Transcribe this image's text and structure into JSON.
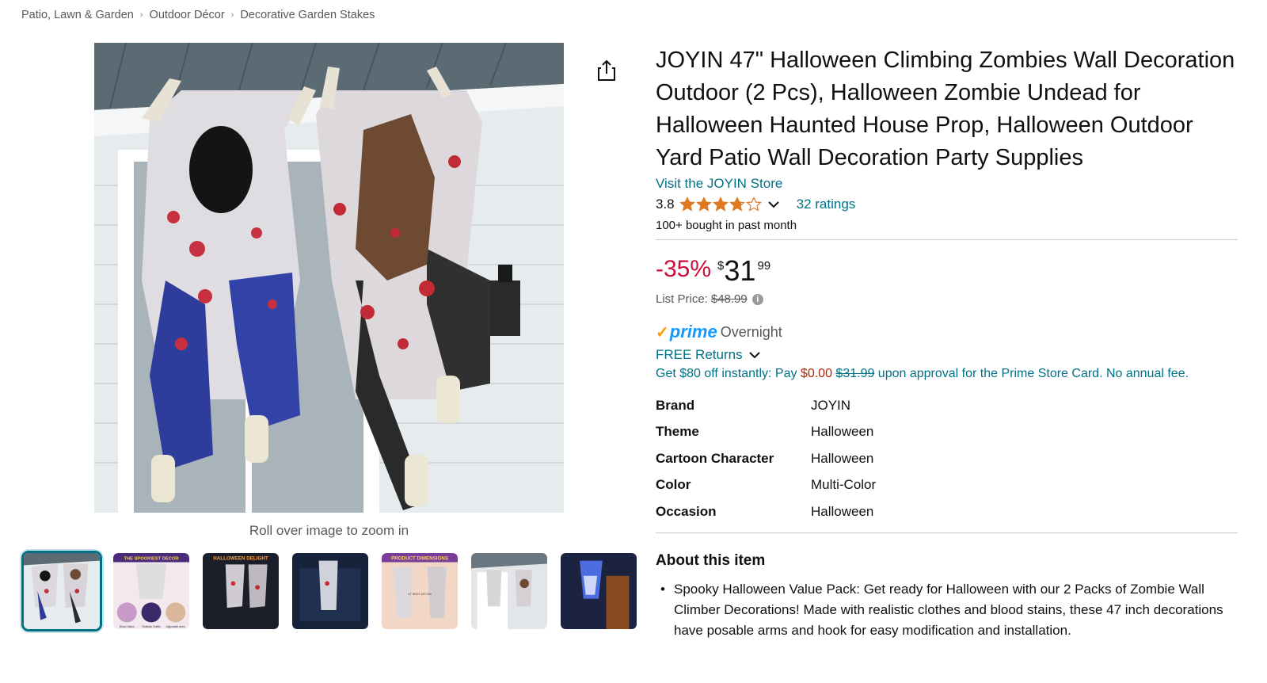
{
  "breadcrumb": [
    "Patio, Lawn & Garden",
    "Outdoor Décor",
    "Decorative Garden Stakes"
  ],
  "breadcrumb_separator": "›",
  "gallery": {
    "zoom_hint": "Roll over image to zoom in",
    "thumbnails": [
      {
        "caption": "",
        "selected": true
      },
      {
        "caption": "THE SPOOKIEST DECOR",
        "footer": [
          "Blood Stains",
          "Realistic Outfits",
          "Adjustable Arms"
        ]
      },
      {
        "caption": "HALLOWEEN DELIGHT"
      },
      {
        "caption": ""
      },
      {
        "caption": "PRODUCT DIMENSIONS",
        "dims": "47 INCH 120 CM"
      },
      {
        "caption": ""
      },
      {
        "caption": ""
      }
    ]
  },
  "product": {
    "title": "JOYIN 47\" Halloween Climbing Zombies Wall Decoration Outdoor (2 Pcs), Halloween Zombie Undead for Halloween Haunted House Prop, Halloween Outdoor Yard Patio Wall Decoration Party Supplies",
    "store_link": "Visit the JOYIN Store",
    "rating": "3.8",
    "rating_value": 3.8,
    "ratings_count": "32 ratings",
    "bought": "100+ bought in past month"
  },
  "price": {
    "discount": "-35%",
    "symbol": "$",
    "whole": "31",
    "fraction": "99",
    "list_label": "List Price:",
    "list_price": "$48.99"
  },
  "delivery": {
    "prime_check": "✓",
    "prime_word": "prime",
    "overnight": "Overnight",
    "returns": "FREE Returns",
    "card_offer_prefix": "Get $80 off instantly: Pay ",
    "card_offer_price": "$0.00",
    "card_offer_strike": "$31.99",
    "card_offer_suffix": " upon approval for the Prime Store Card. No annual fee."
  },
  "specs": [
    {
      "key": "Brand",
      "value": "JOYIN"
    },
    {
      "key": "Theme",
      "value": "Halloween"
    },
    {
      "key": "Cartoon Character",
      "value": "Halloween"
    },
    {
      "key": "Color",
      "value": "Multi-Color"
    },
    {
      "key": "Occasion",
      "value": "Halloween"
    }
  ],
  "about": {
    "title": "About this item",
    "bullets": [
      "Spooky Halloween Value Pack: Get ready for Halloween with our 2 Packs of Zombie Wall Climber Decorations! Made with realistic clothes and blood stains, these 47 inch decorations have posable arms and hook for easy modification and installation."
    ]
  },
  "colors": {
    "link": "#007185",
    "discount": "#cc0c39",
    "prime_blue": "#1399ff",
    "prime_check": "#ff9900",
    "star": "#de7921"
  }
}
